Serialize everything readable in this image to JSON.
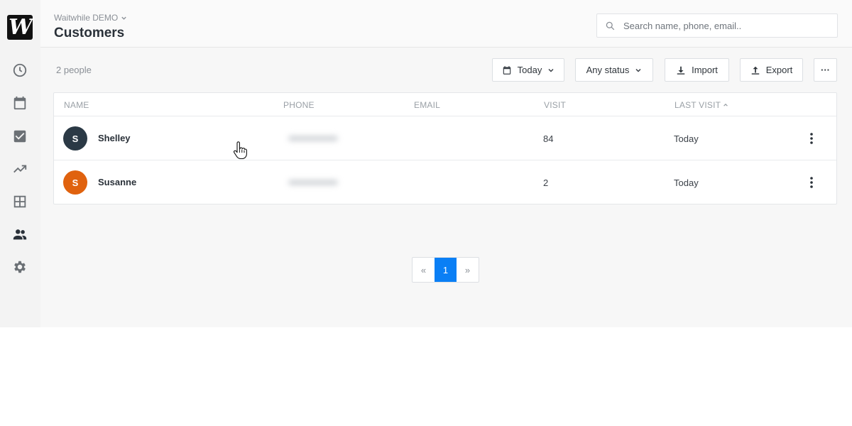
{
  "sidebar": {
    "logo": "W",
    "items": [
      {
        "name": "clock-icon"
      },
      {
        "name": "calendar-icon"
      },
      {
        "name": "checkbox-icon"
      },
      {
        "name": "trending-icon"
      },
      {
        "name": "grid-icon"
      },
      {
        "name": "people-icon",
        "active": true
      },
      {
        "name": "gear-icon"
      }
    ]
  },
  "header": {
    "org": "Waitwhile DEMO",
    "title": "Customers",
    "search_placeholder": "Search name, phone, email.."
  },
  "toolbar": {
    "count": "2 people",
    "date_filter": "Today",
    "status_filter": "Any status",
    "import_label": "Import",
    "export_label": "Export",
    "more_label": "···"
  },
  "table": {
    "columns": [
      "NAME",
      "PHONE",
      "EMAIL",
      "VISIT",
      "LAST VISIT"
    ],
    "rows": [
      {
        "initial": "S",
        "name": "Shelley",
        "visits": "84",
        "last_visit": "Today",
        "avatar_color": "#2b3945"
      },
      {
        "initial": "S",
        "name": "Susanne",
        "visits": "2",
        "last_visit": "Today",
        "avatar_color": "#e0620e"
      }
    ]
  },
  "pagination": {
    "prev": "«",
    "current": "1",
    "next": "»"
  },
  "colors": {
    "accent": "#0a7ff5"
  }
}
